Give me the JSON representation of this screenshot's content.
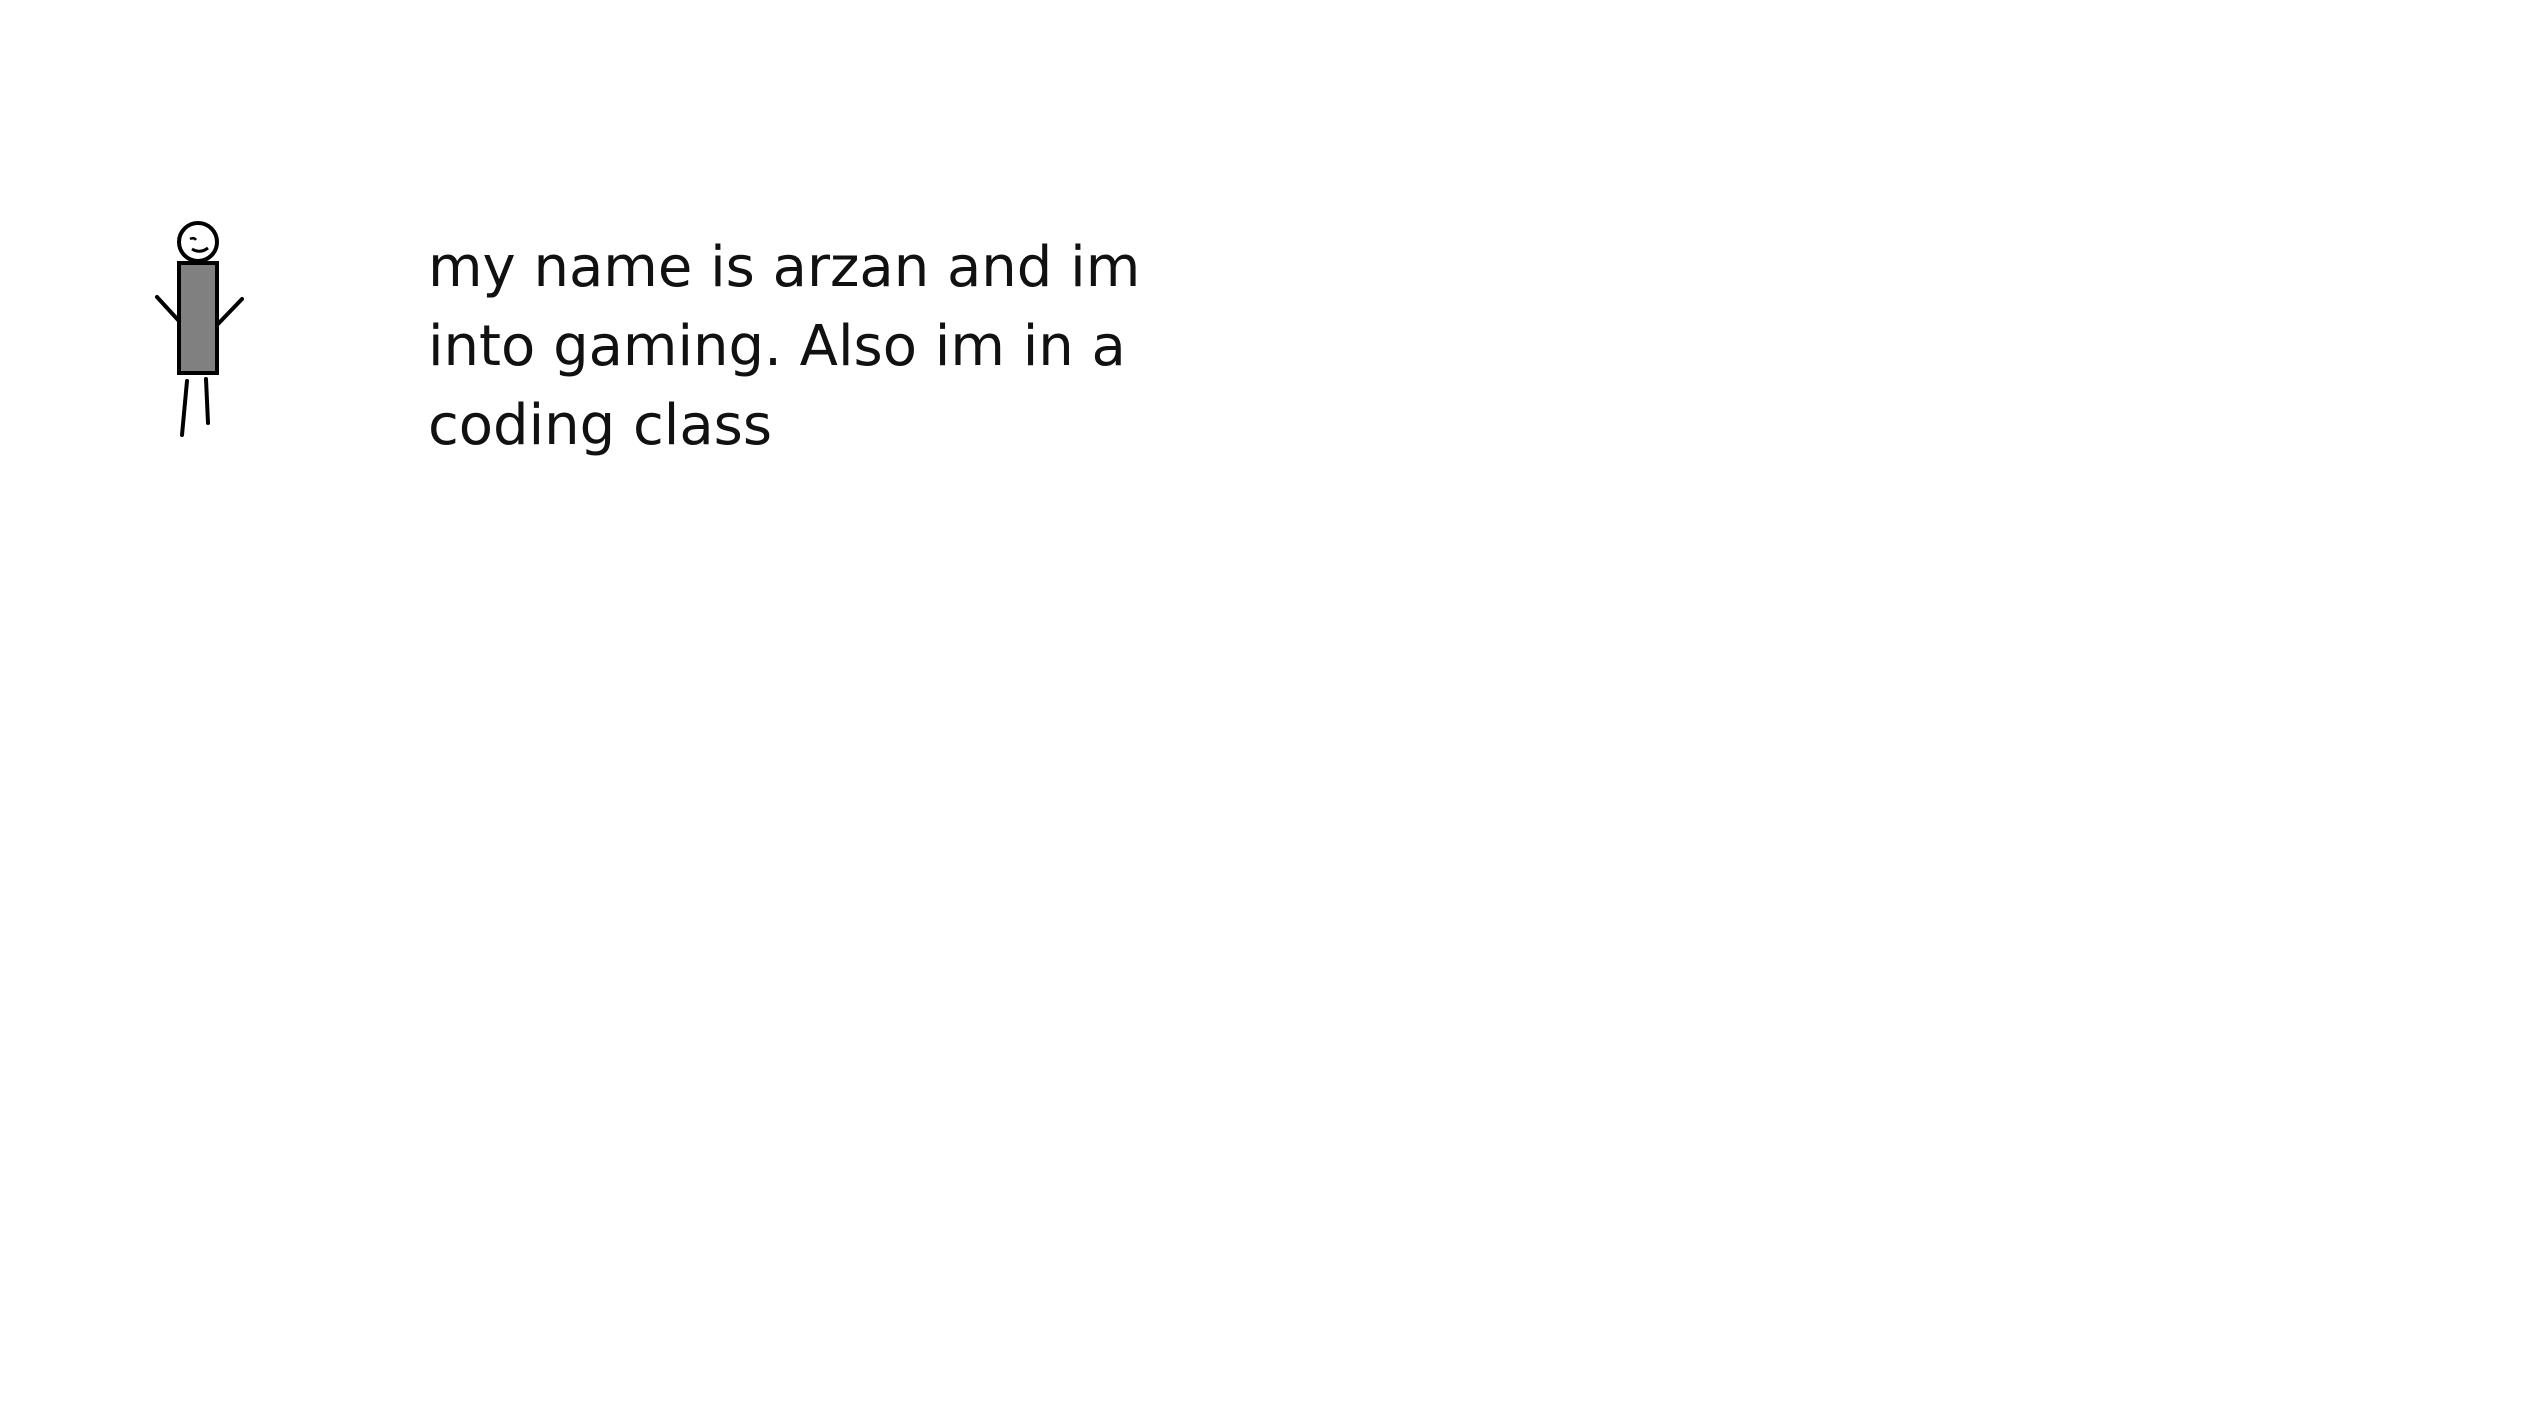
{
  "slide": {
    "body_text": "my name is arzan and im into gaming. Also im in a coding class"
  },
  "figure": {
    "icon": "stick-figure-icon",
    "body_color": "#808080",
    "line_color": "#000000"
  }
}
